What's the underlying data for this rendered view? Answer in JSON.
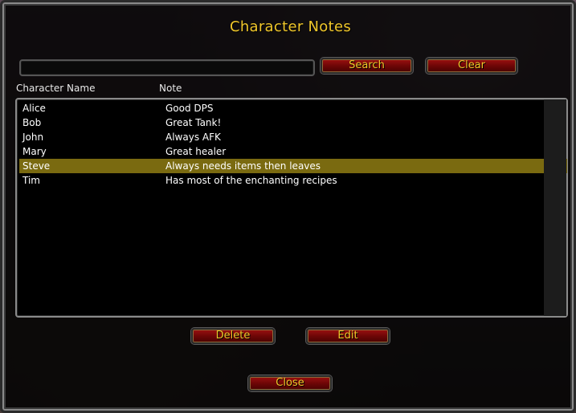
{
  "window": {
    "title": "Character Notes"
  },
  "search": {
    "value": "",
    "search_label": "Search",
    "clear_label": "Clear"
  },
  "columns": {
    "name": "Character Name",
    "note": "Note"
  },
  "rows": [
    {
      "name": "Alice",
      "note": "Good DPS",
      "selected": false
    },
    {
      "name": "Bob",
      "note": "Great Tank!",
      "selected": false
    },
    {
      "name": "John",
      "note": "Always AFK",
      "selected": false
    },
    {
      "name": "Mary",
      "note": "Great healer",
      "selected": false
    },
    {
      "name": "Steve",
      "note": "Always needs items then leaves",
      "selected": true
    },
    {
      "name": "Tim",
      "note": "Has most of the enchanting recipes",
      "selected": false
    }
  ],
  "actions": {
    "delete_label": "Delete",
    "edit_label": "Edit",
    "close_label": "Close"
  },
  "colors": {
    "accent_text": "#f0c72a",
    "button_red": "#8c0c0c",
    "selection": "#7a6a10"
  }
}
